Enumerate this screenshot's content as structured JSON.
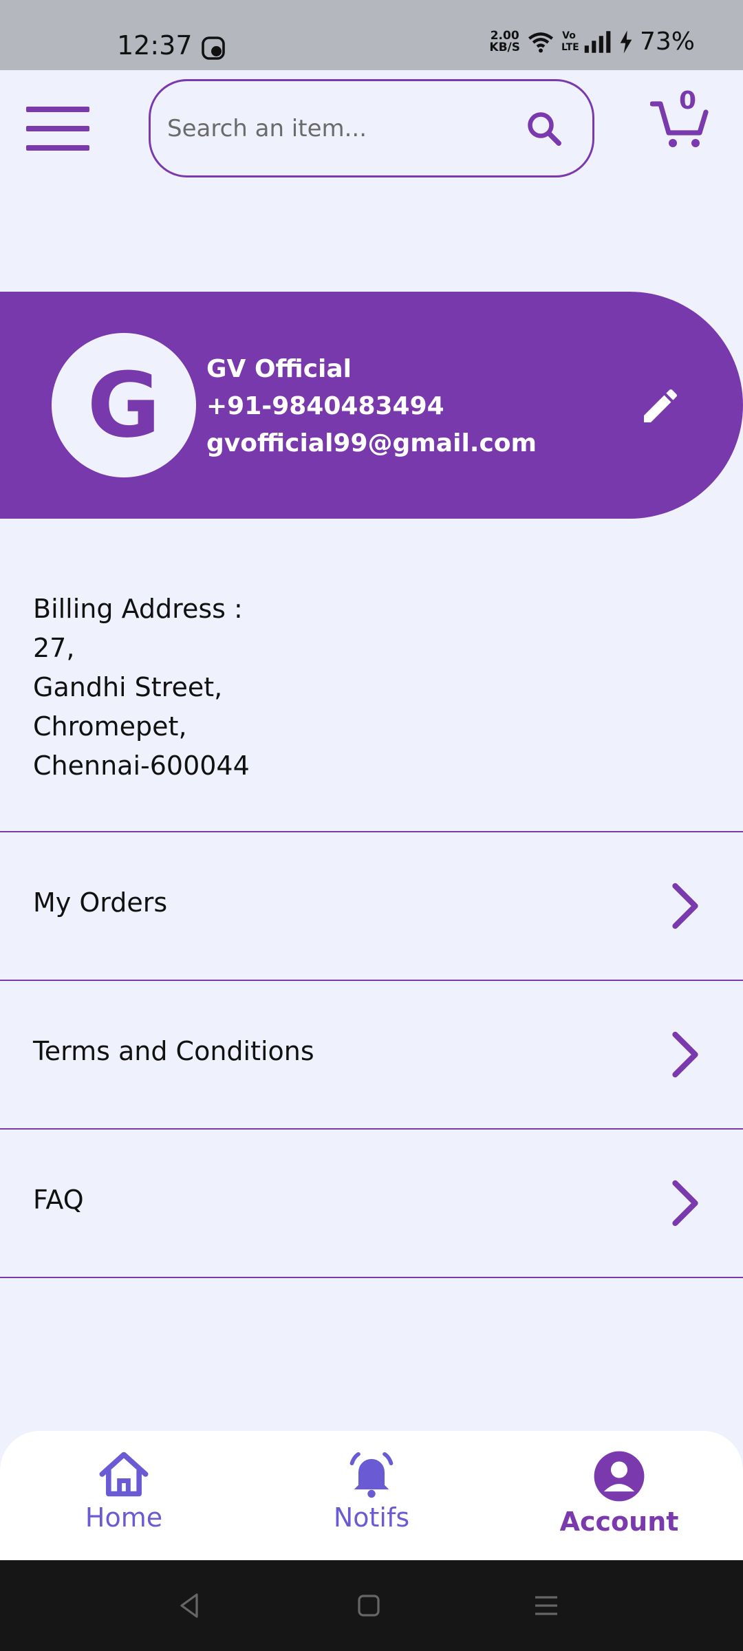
{
  "status_bar": {
    "time": "12:37",
    "net_speed_value": "2.00",
    "net_speed_unit": "KB/S",
    "volte": "Vo LTE",
    "battery": "73%"
  },
  "top_bar": {
    "search_placeholder": "Search an item...",
    "cart_count": "0"
  },
  "profile": {
    "avatar_letter": "G",
    "name": "GV Official",
    "phone": "+91-9840483494",
    "email": "gvofficial99@gmail.com"
  },
  "billing": {
    "heading": "Billing Address :",
    "line1": "27,",
    "line2": "Gandhi Street,",
    "line3": "Chromepet,",
    "line4": "Chennai-600044"
  },
  "menu": {
    "orders": "My Orders",
    "terms": "Terms and Conditions",
    "faq": "FAQ"
  },
  "bottom_nav": {
    "home": "Home",
    "notifs": "Notifs",
    "account": "Account"
  },
  "colors": {
    "primary": "#7739ab",
    "background": "#eff2fd",
    "nav_inactive": "#6a5ad4"
  }
}
